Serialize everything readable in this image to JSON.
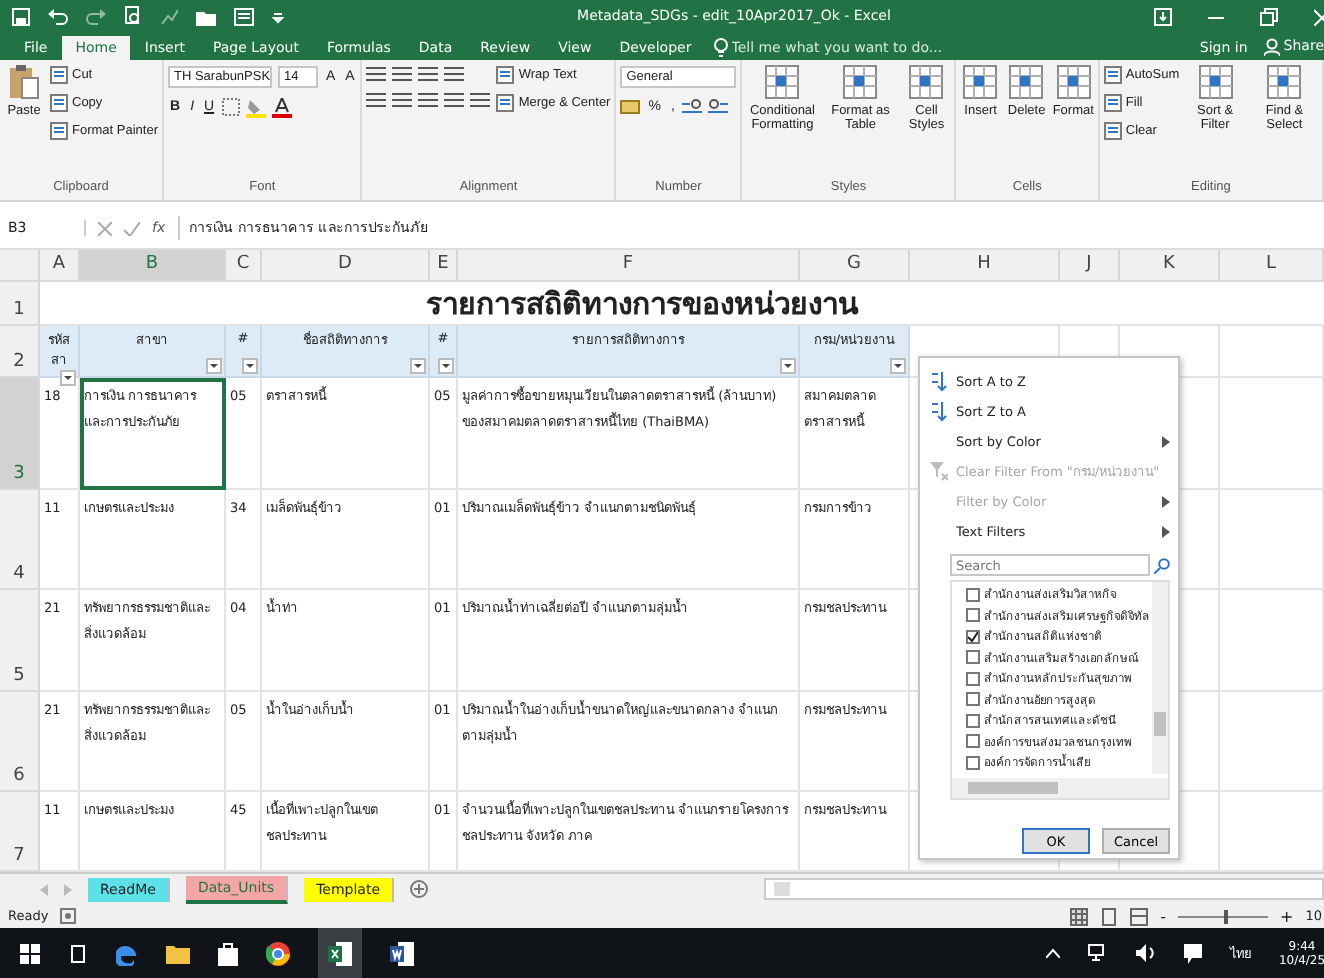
{
  "window": {
    "title": "Metadata_SDGs - edit_10Apr2017_Ok - Excel"
  },
  "menu_tabs": [
    {
      "label": "File",
      "selected": false
    },
    {
      "label": "Home",
      "selected": true
    },
    {
      "label": "Insert",
      "selected": false
    },
    {
      "label": "Page Layout",
      "selected": false
    },
    {
      "label": "Formulas",
      "selected": false
    },
    {
      "label": "Data",
      "selected": false
    },
    {
      "label": "Review",
      "selected": false
    },
    {
      "label": "View",
      "selected": false
    },
    {
      "label": "Developer",
      "selected": false
    }
  ],
  "tell_me": {
    "placeholder": "Tell me what you want to do..."
  },
  "account": {
    "sign_in": "Sign in",
    "share": "Share"
  },
  "ribbon": {
    "groups": [
      {
        "label": "Clipboard",
        "columns": [
          {
            "kind": "paste",
            "label": "Paste"
          },
          {
            "kind": "stack",
            "items": [
              "Cut",
              "Copy",
              "Format Painter"
            ]
          }
        ]
      },
      {
        "label": "Font",
        "columns": [
          {
            "kind": "font",
            "font": "TH SarabunPSK",
            "size": "14",
            "size_buttons": [
              "A",
              "A"
            ],
            "styles": [
              "B",
              "I",
              "U"
            ]
          }
        ]
      },
      {
        "label": "Alignment",
        "columns": [
          {
            "kind": "align"
          },
          {
            "kind": "stack",
            "items": [
              "Wrap Text",
              "Merge & Center"
            ]
          }
        ]
      },
      {
        "label": "Number",
        "columns": [
          {
            "kind": "number",
            "format": "General",
            "symbols": [
              "%",
              ","
            ]
          }
        ]
      },
      {
        "label": "Styles",
        "columns": [
          {
            "kind": "large",
            "label": "Conditional Formatting"
          },
          {
            "kind": "large",
            "label": "Format as Table"
          },
          {
            "kind": "large",
            "label": "Cell Styles"
          }
        ]
      },
      {
        "label": "Cells",
        "columns": [
          {
            "kind": "large",
            "label": "Insert"
          },
          {
            "kind": "large",
            "label": "Delete"
          },
          {
            "kind": "large",
            "label": "Format"
          }
        ]
      },
      {
        "label": "Editing",
        "columns": [
          {
            "kind": "stack",
            "items": [
              "AutoSum",
              "Fill",
              "Clear"
            ]
          },
          {
            "kind": "large",
            "label": "Sort & Filter"
          },
          {
            "kind": "large",
            "label": "Find & Select"
          }
        ]
      }
    ]
  },
  "formula_bar": {
    "name_box": "B3",
    "fx": "fx",
    "value": "การเงิน การธนาคาร และการประกันภัย"
  },
  "columns": [
    "A",
    "B",
    "C",
    "D",
    "E",
    "F",
    "G",
    "H",
    "J",
    "K",
    "L"
  ],
  "sheet_title": {
    "row": "1",
    "text": "รายการสถิติทางการของหน่วยงาน"
  },
  "header_row": {
    "row": "2",
    "cells": [
      "รหัส สา",
      "สาขา",
      "#",
      "ชื่อสถิติทางการ",
      "#",
      "รายการสถิติทางการ",
      "กรม/หน่วยงาน"
    ]
  },
  "rows": [
    {
      "row": "3",
      "code": "18",
      "sector": "การเงิน การธนาคาร และการประกันภัย",
      "selected": true,
      "stat_no": "05",
      "stat_name": "ตราสารหนี้",
      "item_no": "05",
      "item": "มูลค่าการซื้อขายหมุนเวียนในตลาดตราสารหนี้ (ล้านบาท) ของสมาคมตลาดตราสารหนี้ไทย (ThaiBMA)",
      "agency": "สมาคมตลาดตราสารหนี้"
    },
    {
      "row": "4",
      "code": "11",
      "sector": "เกษตรและประมง",
      "selected": false,
      "stat_no": "34",
      "stat_name": "เมล็ดพันธุ์ข้าว",
      "item_no": "01",
      "item": "ปริมาณเมล็ดพันธุ์ข้าว จำแนกตามชนิดพันธุ์",
      "agency": "กรมการข้าว"
    },
    {
      "row": "5",
      "code": "21",
      "sector": "ทรัพยากรธรรมชาติและสิ่งแวดล้อม",
      "selected": false,
      "stat_no": "04",
      "stat_name": "น้ำท่า",
      "item_no": "01",
      "item": "ปริมาณน้ำท่าเฉลี่ยต่อปี จำแนกตามลุ่มน้ำ",
      "agency": "กรมชลประทาน"
    },
    {
      "row": "6",
      "code": "21",
      "sector": "ทรัพยากรธรรมชาติและสิ่งแวดล้อม",
      "selected": false,
      "stat_no": "05",
      "stat_name": "น้ำในอ่างเก็บน้ำ",
      "item_no": "01",
      "item": "ปริมาณน้ำในอ่างเก็บน้ำขนาดใหญ่และขนาดกลาง จำแนกตามลุ่มน้ำ",
      "agency": "กรมชลประทาน"
    },
    {
      "row": "7",
      "code": "11",
      "sector": "เกษตรและประมง",
      "selected": false,
      "stat_no": "45",
      "stat_name": "เนื้อที่เพาะปลูกในเขตชลประทาน",
      "item_no": "01",
      "item": "จำนวนเนื้อที่เพาะปลูกในเขตชลประทาน จำแนกรายโครงการชลประทาน จังหวัด ภาค",
      "agency": "กรมชลประทาน"
    }
  ],
  "filter_menu": {
    "items": [
      {
        "label": "Sort A to Z",
        "kind": "sort-up",
        "disabled": false,
        "submenu": false
      },
      {
        "label": "Sort Z to A",
        "kind": "sort-down",
        "disabled": false,
        "submenu": false
      },
      {
        "label": "Sort by Color",
        "kind": "plain",
        "disabled": false,
        "submenu": true
      },
      {
        "label": "Clear Filter From \"กรม/หน่วยงาน\"",
        "kind": "clear",
        "disabled": true,
        "submenu": false
      },
      {
        "label": "Filter by Color",
        "kind": "plain",
        "disabled": true,
        "submenu": true
      },
      {
        "label": "Text Filters",
        "kind": "plain",
        "disabled": false,
        "submenu": true
      }
    ],
    "search": {
      "placeholder": "Search"
    },
    "values": [
      {
        "label": "สำนักงานส่งเสริมวิสาหกิจ",
        "checked": false
      },
      {
        "label": "สำนักงานส่งเสริมเศรษฐกิจดิจิทัล",
        "checked": false
      },
      {
        "label": "สำนักงานสถิติแห่งชาติ",
        "checked": true
      },
      {
        "label": "สำนักงานเสริมสร้างเอกลักษณ์",
        "checked": false
      },
      {
        "label": "สำนักงานหลักประกันสุขภาพ",
        "checked": false
      },
      {
        "label": "สำนักงานอัยการสูงสุด",
        "checked": false
      },
      {
        "label": "สำนักสารสนเทศและดัชนี",
        "checked": false
      },
      {
        "label": "องค์การขนส่งมวลชนกรุงเทพ",
        "checked": false
      },
      {
        "label": "องค์การจัดการน้ำเสีย",
        "checked": false
      }
    ],
    "buttons": [
      "OK",
      "Cancel"
    ]
  },
  "sheet_tabs": [
    {
      "label": "ReadMe",
      "color": "#5ce1e6",
      "selected": false
    },
    {
      "label": "Data_Units",
      "color": "#f4a6a6",
      "selected": true
    },
    {
      "label": "Template",
      "color": "#ffff00",
      "selected": false
    }
  ],
  "status_bar": {
    "text": "Ready",
    "zoom_out": "-",
    "zoom_slider": {
      "level": 0.5
    },
    "zoom_in": "+",
    "zoom": "10"
  },
  "taskbar": {
    "time": "9:44",
    "date": "10/4/25",
    "language": "ไทย"
  }
}
